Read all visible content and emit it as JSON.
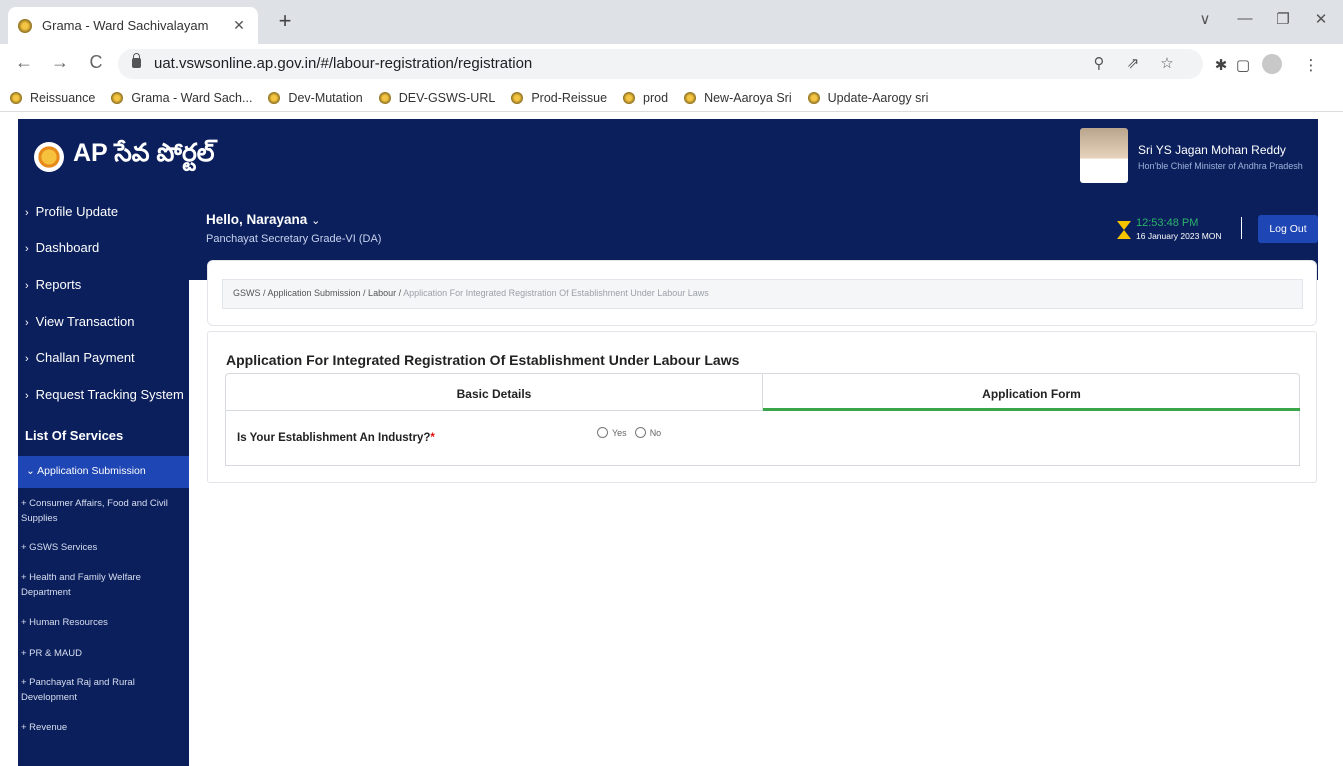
{
  "browser": {
    "tab_title": "Grama - Ward Sachivalayam",
    "tab_close": "✕",
    "new_tab": "+",
    "url": "uat.vswsonline.ap.gov.in/#/labour-registration/registration",
    "bookmarks": [
      "Reissuance",
      "Grama - Ward Sach...",
      "Dev-Mutation",
      "DEV-GSWS-URL",
      "Prod-Reissue",
      "prod",
      "New-Aaroya Sri",
      "Update-Aarogy sri"
    ],
    "icons": {
      "back": "←",
      "forward": "→",
      "reload": "C",
      "zoom": "⚲",
      "share": "⇗",
      "star": "☆",
      "extensions": "✱",
      "sidepanel": "▢",
      "menu": "⋮",
      "minimize_caret": "∨",
      "minimize": "—",
      "restore": "❐",
      "close": "✕"
    }
  },
  "header": {
    "logo_text": "AP సేవ పోర్టల్",
    "cm_name": "Sri YS Jagan Mohan Reddy",
    "cm_title": "Hon'ble Chief Minister of Andhra Pradesh"
  },
  "sidebar": {
    "chevron": "›",
    "items": [
      {
        "label": "Profile Update"
      },
      {
        "label": "Dashboard"
      },
      {
        "label": "Reports"
      },
      {
        "label": "View Transaction"
      },
      {
        "label": "Challan Payment"
      },
      {
        "label": "Request Tracking System"
      }
    ],
    "services_heading": "List Of Services",
    "active_section": "Application Submission",
    "active_chevron": "⌄",
    "sub_items": [
      {
        "label": "+ Consumer Affairs, Food and Civil Supplies"
      },
      {
        "label": "+ GSWS Services"
      },
      {
        "label": "+ Health and Family Welfare Department"
      },
      {
        "label": "+ Human Resources"
      },
      {
        "label": "+ PR & MAUD"
      },
      {
        "label": "+ Panchayat Raj and Rural Development"
      },
      {
        "label": "+ Revenue"
      }
    ]
  },
  "userbar": {
    "greeting": "Hello, Narayana",
    "greeting_caret": "⌄",
    "role": "Panchayat Secretary Grade-VI (DA)",
    "time": "12:53:48 PM",
    "date": "16 January 2023 MON",
    "logout_label": "Log Out"
  },
  "breadcrumb": {
    "path": "GSWS / Application Submission / Labour / ",
    "current": "Application For Integrated Registration Of Establishment Under Labour Laws"
  },
  "form": {
    "title": "Application For Integrated Registration Of Establishment Under Labour Laws",
    "tabs": [
      "Basic Details",
      "Application Form"
    ],
    "active_tab": "Application Form",
    "question": "Is Your Establishment An Industry?",
    "required_mark": "*",
    "options": [
      "Yes",
      "No"
    ]
  },
  "colors": {
    "navy": "#0b1f5c",
    "active_blue": "#1e46b4",
    "tab_underline": "#3aa64a",
    "clock_green": "#2bb36a",
    "hourglass_yellow": "#f5c400"
  }
}
